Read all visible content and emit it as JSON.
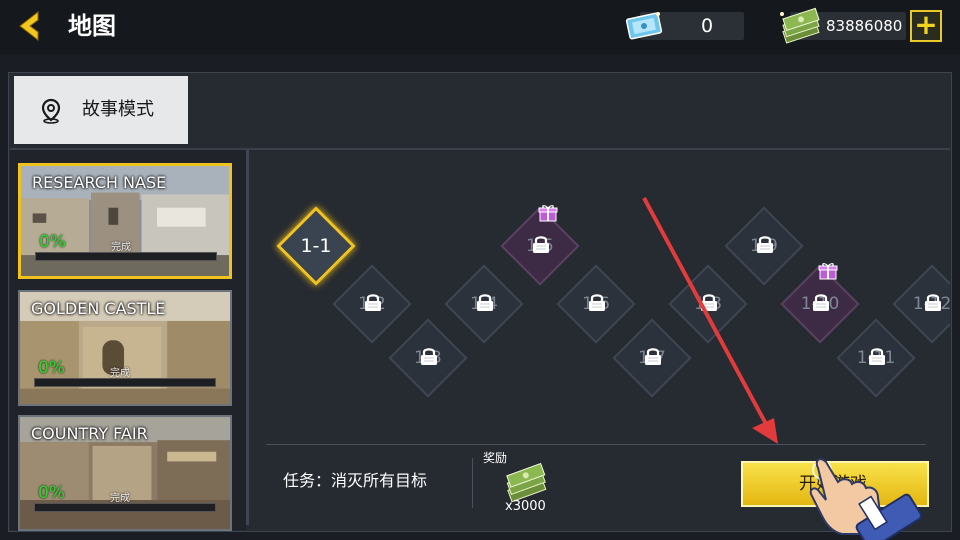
{
  "header": {
    "title": "地图",
    "tickets": "0",
    "cash": "83886080",
    "plus": "+"
  },
  "mode_tab": {
    "label": "故事模式"
  },
  "maps": [
    {
      "name": "RESEARCH NASE",
      "progress": "0%",
      "status": "完成",
      "selected": true
    },
    {
      "name": "GOLDEN CASTLE",
      "progress": "0%",
      "status": "完成",
      "selected": false
    },
    {
      "name": "COUNTRY FAIR",
      "progress": "0%",
      "status": "完成",
      "selected": false
    }
  ],
  "levels": [
    {
      "label": "1-1",
      "locked": false,
      "gift": false,
      "current": true
    },
    {
      "label": "1-2",
      "locked": true,
      "gift": false
    },
    {
      "label": "1-3",
      "locked": true,
      "gift": false
    },
    {
      "label": "1-4",
      "locked": true,
      "gift": false
    },
    {
      "label": "1-5",
      "locked": true,
      "gift": true
    },
    {
      "label": "1-6",
      "locked": true,
      "gift": false
    },
    {
      "label": "1-7",
      "locked": true,
      "gift": false
    },
    {
      "label": "1-8",
      "locked": true,
      "gift": false
    },
    {
      "label": "1-9",
      "locked": true,
      "gift": false
    },
    {
      "label": "1-10",
      "locked": true,
      "gift": true
    },
    {
      "label": "1-11",
      "locked": true,
      "gift": false
    },
    {
      "label": "1-12",
      "locked": true,
      "gift": false
    }
  ],
  "mission": {
    "text": "任务：消灭所有目标"
  },
  "reward": {
    "label": "奖励",
    "quantity": "x3000"
  },
  "start_button": {
    "label": "开始游戏"
  },
  "colors": {
    "accent": "#f0c21d",
    "progress_green": "#2bd72b",
    "gift_purple": "#3d2a44",
    "arrow_red": "#e23b3b"
  }
}
